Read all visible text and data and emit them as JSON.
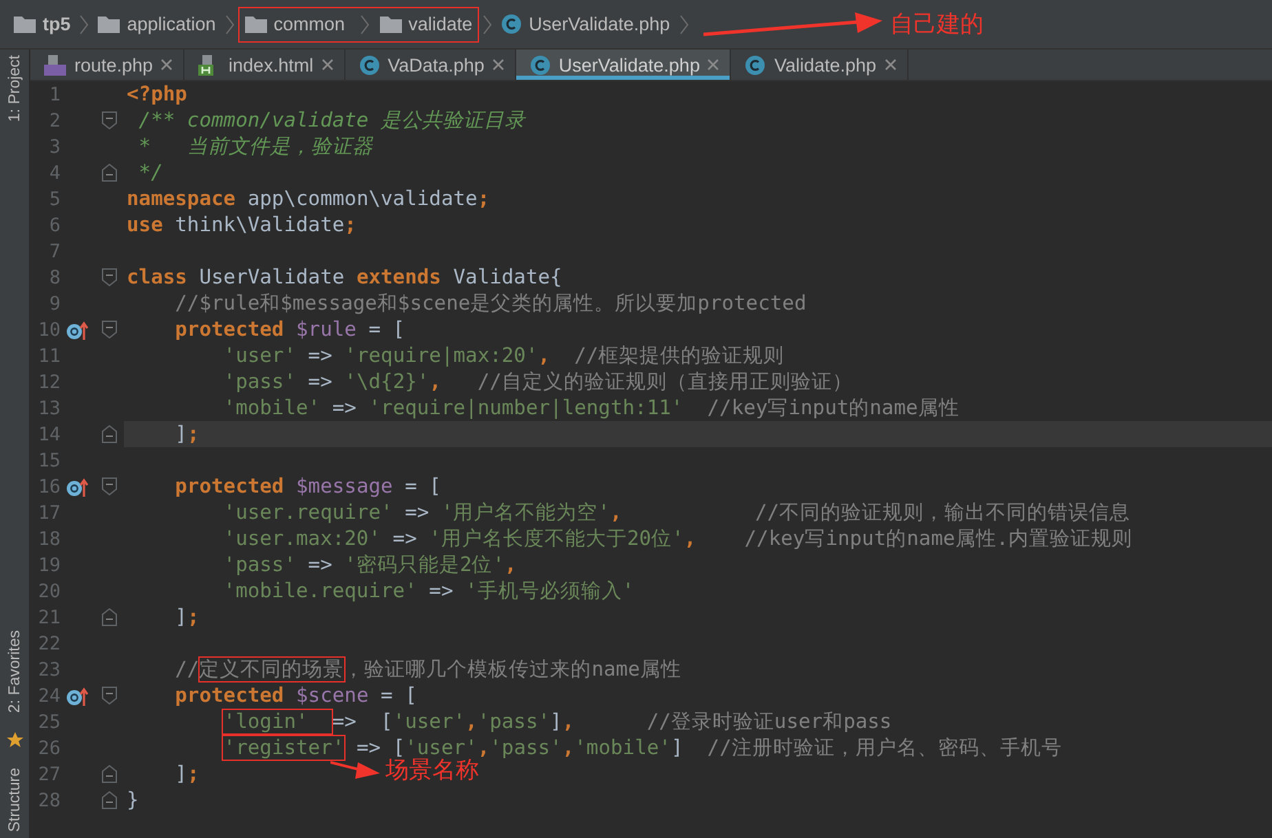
{
  "breadcrumbs": [
    {
      "label": "tp5",
      "kind": "folder",
      "root": true,
      "boxed": false
    },
    {
      "label": "application",
      "kind": "folder",
      "root": false,
      "boxed": false
    },
    {
      "label": "common",
      "kind": "folder",
      "root": false,
      "boxed": true
    },
    {
      "label": "validate",
      "kind": "folder",
      "root": false,
      "boxed": true
    },
    {
      "label": "UserValidate.php",
      "kind": "class",
      "root": false,
      "boxed": false
    }
  ],
  "breadcrumb_callout": "自己建的",
  "tool_strip": {
    "top": [
      "1: Project"
    ],
    "bottom": [
      "2: Favorites",
      "Structure"
    ]
  },
  "tabs": [
    {
      "label": "route.php",
      "kind": "php",
      "selected": false
    },
    {
      "label": "index.html",
      "kind": "html",
      "selected": false
    },
    {
      "label": "VaData.php",
      "kind": "class",
      "selected": false
    },
    {
      "label": "UserValidate.php",
      "kind": "class",
      "selected": true
    },
    {
      "label": "Validate.php",
      "kind": "class",
      "selected": false
    }
  ],
  "lines": [
    {
      "number": "1",
      "tokens": [
        {
          "kind": "keyword",
          "text": "<?php"
        }
      ]
    },
    {
      "number": "2",
      "gutter": [
        {
          "kind": "fold_start"
        }
      ],
      "tokens": [
        {
          "kind": "doc",
          "text": " /** common/validate 是公共验证目录"
        }
      ]
    },
    {
      "number": "3",
      "tokens": [
        {
          "kind": "doc",
          "text": " *   当前文件是，验证器"
        }
      ]
    },
    {
      "number": "4",
      "gutter": [
        {
          "kind": "fold_end"
        }
      ],
      "tokens": [
        {
          "kind": "doc",
          "text": " */"
        }
      ]
    },
    {
      "number": "5",
      "tokens": [
        {
          "kind": "keyword",
          "text": "namespace"
        },
        {
          "kind": "text",
          "text": " app\\common\\validate"
        },
        {
          "kind": "keyword",
          "text": ";"
        }
      ]
    },
    {
      "number": "6",
      "tokens": [
        {
          "kind": "keyword",
          "text": "use"
        },
        {
          "kind": "text",
          "text": " think\\Validate"
        },
        {
          "kind": "keyword",
          "text": ";"
        }
      ]
    },
    {
      "number": "7"
    },
    {
      "number": "8",
      "gutter": [
        {
          "kind": "fold_start"
        }
      ],
      "tokens": [
        {
          "kind": "keyword",
          "text": "class"
        },
        {
          "kind": "text",
          "text": " UserValidate "
        },
        {
          "kind": "keyword",
          "text": "extends"
        },
        {
          "kind": "text",
          "text": " Validate{"
        }
      ]
    },
    {
      "number": "9",
      "tokens": [
        {
          "kind": "comment",
          "text": "    //$rule和$message和$scene是父类的属性。所以要加protected"
        }
      ]
    },
    {
      "number": "10",
      "gutter": [
        {
          "kind": "override"
        },
        {
          "kind": "fold_start"
        }
      ],
      "tokens": [
        {
          "kind": "keyword",
          "text": "    protected"
        },
        {
          "kind": "variable",
          "text": " $rule"
        },
        {
          "kind": "text",
          "text": " = ["
        }
      ]
    },
    {
      "number": "11",
      "tokens": [
        {
          "kind": "string",
          "text": "        'user'"
        },
        {
          "kind": "text",
          "text": " => "
        },
        {
          "kind": "string",
          "text": "'require|max:20'"
        },
        {
          "kind": "keyword",
          "text": ","
        },
        {
          "kind": "comment",
          "text": "  //框架提供的验证规则"
        }
      ]
    },
    {
      "number": "12",
      "tokens": [
        {
          "kind": "string",
          "text": "        'pass'"
        },
        {
          "kind": "text",
          "text": " => "
        },
        {
          "kind": "string",
          "text": "'\\d{2}'"
        },
        {
          "kind": "keyword",
          "text": ","
        },
        {
          "kind": "comment",
          "text": "   //自定义的验证规则（直接用正则验证）"
        }
      ]
    },
    {
      "number": "13",
      "tokens": [
        {
          "kind": "string",
          "text": "        'mobile'"
        },
        {
          "kind": "text",
          "text": " => "
        },
        {
          "kind": "string",
          "text": "'require|number|length:11'"
        },
        {
          "kind": "comment",
          "text": "  //key写input的name属性"
        }
      ]
    },
    {
      "number": "14",
      "gutter": [
        {
          "kind": "fold_end"
        }
      ],
      "current": true,
      "tokens": [
        {
          "kind": "text",
          "text": "    ]"
        },
        {
          "kind": "keyword",
          "text": ";"
        }
      ]
    },
    {
      "number": "15"
    },
    {
      "number": "16",
      "gutter": [
        {
          "kind": "override"
        },
        {
          "kind": "fold_start"
        }
      ],
      "tokens": [
        {
          "kind": "keyword",
          "text": "    protected"
        },
        {
          "kind": "variable",
          "text": " $message"
        },
        {
          "kind": "text",
          "text": " = ["
        }
      ]
    },
    {
      "number": "17",
      "tokens": [
        {
          "kind": "string",
          "text": "        'user.require'"
        },
        {
          "kind": "text",
          "text": " => "
        },
        {
          "kind": "string",
          "text": "'用户名不能为空'"
        },
        {
          "kind": "keyword",
          "text": ","
        },
        {
          "kind": "comment",
          "text": "           //不同的验证规则，输出不同的错误信息"
        }
      ]
    },
    {
      "number": "18",
      "tokens": [
        {
          "kind": "string",
          "text": "        'user.max:20'"
        },
        {
          "kind": "text",
          "text": " => "
        },
        {
          "kind": "string",
          "text": "'用户名长度不能大于20位'"
        },
        {
          "kind": "keyword",
          "text": ","
        },
        {
          "kind": "comment",
          "text": "    //key写input的name属性.内置验证规则"
        }
      ]
    },
    {
      "number": "19",
      "tokens": [
        {
          "kind": "string",
          "text": "        'pass'"
        },
        {
          "kind": "text",
          "text": " => "
        },
        {
          "kind": "string",
          "text": "'密码只能是2位'"
        },
        {
          "kind": "keyword",
          "text": ","
        }
      ]
    },
    {
      "number": "20",
      "tokens": [
        {
          "kind": "string",
          "text": "        'mobile.require'"
        },
        {
          "kind": "text",
          "text": " => "
        },
        {
          "kind": "string",
          "text": "'手机号必须输入'"
        }
      ]
    },
    {
      "number": "21",
      "gutter": [
        {
          "kind": "fold_end"
        }
      ],
      "tokens": [
        {
          "kind": "text",
          "text": "    ]"
        },
        {
          "kind": "keyword",
          "text": ";"
        }
      ]
    },
    {
      "number": "22"
    },
    {
      "number": "23",
      "tokens": [
        {
          "kind": "comment",
          "text": "    //"
        },
        {
          "kind": "comment",
          "text": "定义不同的场景",
          "boxed": true
        },
        {
          "kind": "comment",
          "text": "，验证哪几个模板传过来的name属性"
        }
      ]
    },
    {
      "number": "24",
      "gutter": [
        {
          "kind": "override"
        },
        {
          "kind": "fold_start"
        }
      ],
      "tokens": [
        {
          "kind": "keyword",
          "text": "    protected"
        },
        {
          "kind": "variable",
          "text": " $scene"
        },
        {
          "kind": "text",
          "text": " = ["
        }
      ]
    },
    {
      "number": "25",
      "tokens": [
        {
          "kind": "string",
          "text": "        'login'  ",
          "boxed": true
        },
        {
          "kind": "text",
          "text": "=>  ["
        },
        {
          "kind": "string",
          "text": "'user'"
        },
        {
          "kind": "keyword",
          "text": ","
        },
        {
          "kind": "string",
          "text": "'pass'"
        },
        {
          "kind": "text",
          "text": "]"
        },
        {
          "kind": "keyword",
          "text": ","
        },
        {
          "kind": "comment",
          "text": "      //登录时验证user和pass"
        }
      ]
    },
    {
      "number": "26",
      "tokens": [
        {
          "kind": "string",
          "text": "        'register'",
          "boxed": true
        },
        {
          "kind": "text",
          "text": " => ["
        },
        {
          "kind": "string",
          "text": "'user'"
        },
        {
          "kind": "keyword",
          "text": ","
        },
        {
          "kind": "string",
          "text": "'pass'"
        },
        {
          "kind": "keyword",
          "text": ","
        },
        {
          "kind": "string",
          "text": "'mobile'"
        },
        {
          "kind": "text",
          "text": "]"
        },
        {
          "kind": "comment",
          "text": "  //注册时验证，用户名、密码、手机号"
        }
      ]
    },
    {
      "number": "27",
      "gutter": [
        {
          "kind": "fold_end"
        }
      ],
      "callout": "场景名称",
      "tokens": [
        {
          "kind": "text",
          "text": "    ]"
        },
        {
          "kind": "keyword",
          "text": ";"
        }
      ]
    },
    {
      "number": "28",
      "gutter": [
        {
          "kind": "fold_end"
        }
      ],
      "tokens": [
        {
          "kind": "text",
          "text": "}"
        }
      ]
    }
  ]
}
